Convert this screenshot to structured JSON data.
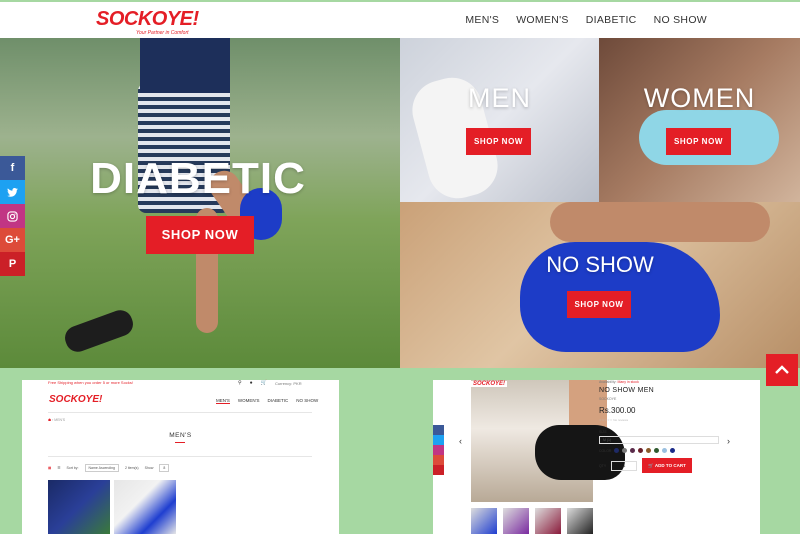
{
  "brand": {
    "logo": "SOCKOYE!",
    "tagline": "Your Partner in Comfort"
  },
  "nav": [
    "MEN'S",
    "WOMEN'S",
    "DIABETIC",
    "NO SHOW"
  ],
  "hero": {
    "diabetic": {
      "title": "DIABETIC",
      "button": "SHOP NOW"
    },
    "men": {
      "title": "MEN",
      "button": "SHOP NOW"
    },
    "women": {
      "title": "WOMEN",
      "button": "SHOP NOW"
    },
    "noshow": {
      "title": "NO SHOW",
      "button": "SHOP NOW"
    }
  },
  "social": [
    "f",
    "t",
    "ig",
    "G+",
    "P"
  ],
  "colors": {
    "accent": "#e41e26",
    "background": "#a6d8a2"
  },
  "preview_left": {
    "free_shipping": "Free Shipping when you order 5 or more Socks!",
    "logo": "SOCKOYE!",
    "currency": "Currency: PKR",
    "nav": [
      "MEN'S",
      "WOMEN'S",
      "DIABETIC",
      "NO SHOW"
    ],
    "breadcrumb": "MEN'S",
    "title": "MEN'S",
    "sort_label": "Sort by:",
    "sort_value": "Name Ascending",
    "count": "2 item(s)",
    "show_label": "Show",
    "show_value": "8"
  },
  "preview_right": {
    "img_logo": "SOCKOYE!",
    "availability_label": "Availability:",
    "availability_value": "Many in stock",
    "name": "NO SHOW MEN",
    "brand": "SOCKOYE",
    "price": "Rs.300.00",
    "reviews": "No reviews",
    "size_label": "SIZE",
    "size_value": "M (1)",
    "color_label": "COLOR",
    "qty_label": "QTY",
    "qty_value": "1",
    "add_to_cart": "ADD TO CART",
    "swatches": [
      "#1e2a66",
      "#7a7a7a",
      "#5b2b4a",
      "#6b1f2a",
      "#8a5a2a",
      "#2f5a2f",
      "#9ac0e0",
      "#1a2a88"
    ]
  }
}
